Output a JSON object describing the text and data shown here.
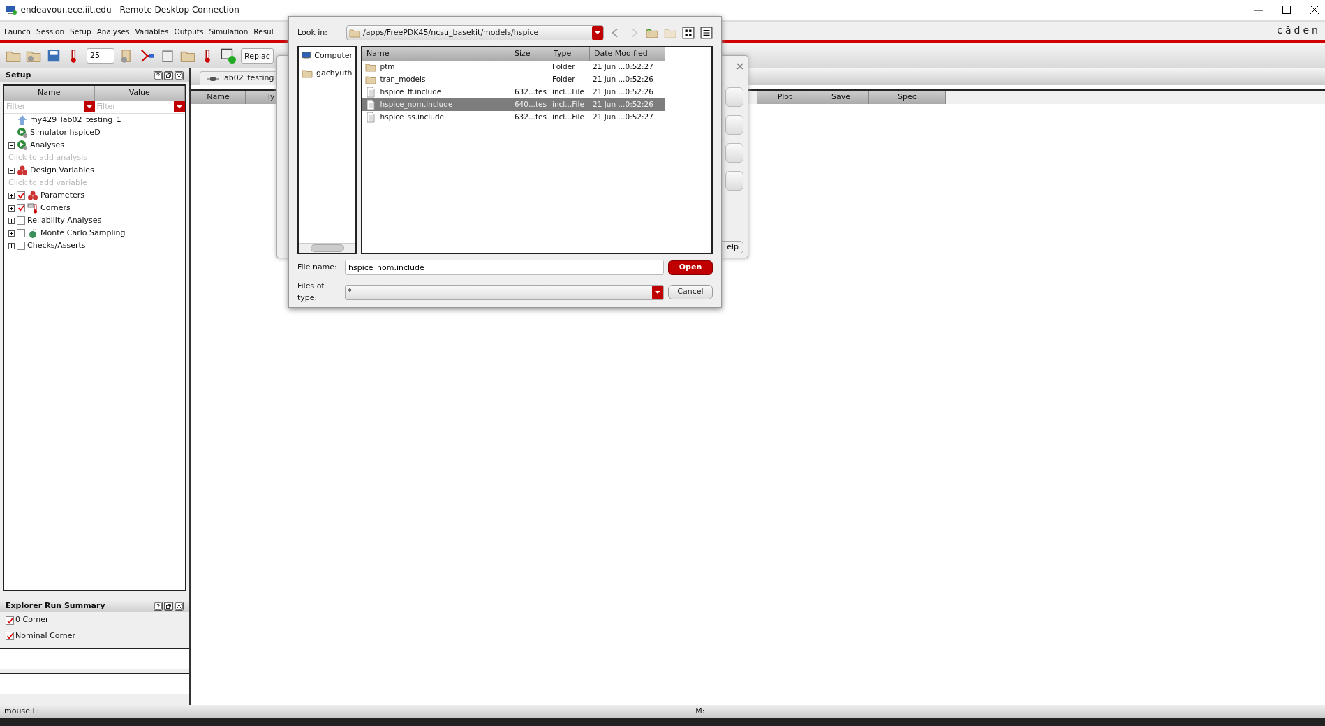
{
  "window": {
    "title": "endeavour.ece.iit.edu - Remote Desktop Connection"
  },
  "menu": [
    "Launch",
    "Session",
    "Setup",
    "Analyses",
    "Variables",
    "Outputs",
    "Simulation",
    "Resul"
  ],
  "logo": "cāden",
  "toolbar": {
    "temperature": "25",
    "combo": "Replac"
  },
  "setup_panel": {
    "title": "Setup",
    "columns": [
      "Name",
      "Value"
    ],
    "filters": [
      {
        "placeholder": "Filter"
      },
      {
        "placeholder": "Filter"
      }
    ],
    "tree": [
      {
        "label": "my429_lab02_testing_1",
        "kind": "cellview"
      },
      {
        "label": "Simulator  hspiceD",
        "kind": "simulator"
      },
      {
        "label": "Analyses",
        "kind": "analyses",
        "expanded": true,
        "children": [
          {
            "label": "Click to add analysis",
            "kind": "hint"
          }
        ]
      },
      {
        "label": "Design Variables",
        "kind": "variables",
        "expanded": true,
        "children": [
          {
            "label": "Click to add variable",
            "kind": "hint"
          }
        ]
      },
      {
        "label": "Parameters",
        "kind": "parameters",
        "expanded": false,
        "checked": true
      },
      {
        "label": "Corners",
        "kind": "corners",
        "expanded": false,
        "checked": true
      },
      {
        "label": "Reliability Analyses",
        "kind": "plain",
        "expanded": false,
        "checked": false
      },
      {
        "label": "Monte Carlo Sampling",
        "kind": "montecarlo",
        "expanded": false,
        "checked": false
      },
      {
        "label": "Checks/Asserts",
        "kind": "plain",
        "expanded": false,
        "checked": false
      }
    ]
  },
  "run_summary": {
    "title": "Explorer Run Summary",
    "items": [
      {
        "label": "0 Corner",
        "checked": true
      },
      {
        "label": "Nominal Corner",
        "checked": true
      }
    ]
  },
  "main": {
    "tab": "lab02_testing",
    "columns": [
      "Name",
      "Ty",
      "Plot",
      "Save",
      "Spec"
    ]
  },
  "back_dialog": {
    "help_button": "elp"
  },
  "file_dialog": {
    "look_in_label": "Look in:",
    "look_in": "/apps/FreePDK45/ncsu_basekit/models/hspice",
    "places": [
      {
        "label": "Computer",
        "kind": "computer"
      },
      {
        "label": "gachyuth",
        "kind": "folder"
      }
    ],
    "columns": [
      "Name",
      "Size",
      "Type",
      "Date Modified"
    ],
    "files": [
      {
        "name": "ptm",
        "type": "Folder",
        "date": "21 Jun ...0:52:27",
        "kind": "folder",
        "selected": false
      },
      {
        "name": "tran_models",
        "type": "Folder",
        "date": "21 Jun ...0:52:26",
        "kind": "folder",
        "selected": false
      },
      {
        "name": "hspice_ff.include",
        "size": "632...tes",
        "type": "incl...File",
        "date": "21 Jun ...0:52:26",
        "kind": "file",
        "selected": false
      },
      {
        "name": "hspice_nom.include",
        "size": "640...tes",
        "type": "incl...File",
        "date": "21 Jun ...0:52:26",
        "kind": "file",
        "selected": true
      },
      {
        "name": "hspice_ss.include",
        "size": "632...tes",
        "type": "incl...File",
        "date": "21 Jun ...0:52:27",
        "kind": "file",
        "selected": false
      }
    ],
    "file_name_label": "File name:",
    "file_name": "hspice_nom.include",
    "type_label": "Files of type:",
    "file_type": "*",
    "buttons": [
      {
        "label": "Open",
        "kind": "primary"
      },
      {
        "label": "Cancel",
        "kind": "secondary"
      }
    ]
  },
  "status_bar": {
    "left": "mouse L:",
    "right": "M:"
  }
}
